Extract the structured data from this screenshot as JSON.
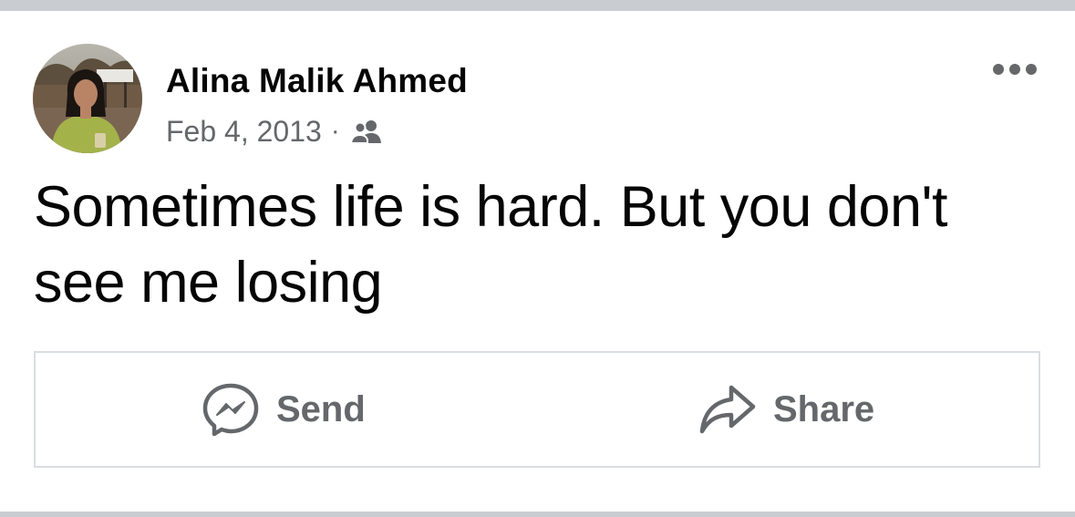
{
  "post": {
    "author_name": "Alina Malik Ahmed",
    "date": "Feb 4, 2013",
    "separator": "·",
    "audience_icon": "friends-icon",
    "text": "Sometimes life is hard. But you don't see me losing"
  },
  "actions": {
    "send_label": "Send",
    "send_icon": "messenger-icon",
    "share_label": "Share",
    "share_icon": "share-arrow-icon"
  },
  "menu": {
    "icon": "more-options-icon"
  },
  "colors": {
    "primary_text": "#050505",
    "secondary_text": "#65676b",
    "divider": "#c9ccd1",
    "border": "#dadde1",
    "background": "#ffffff"
  }
}
